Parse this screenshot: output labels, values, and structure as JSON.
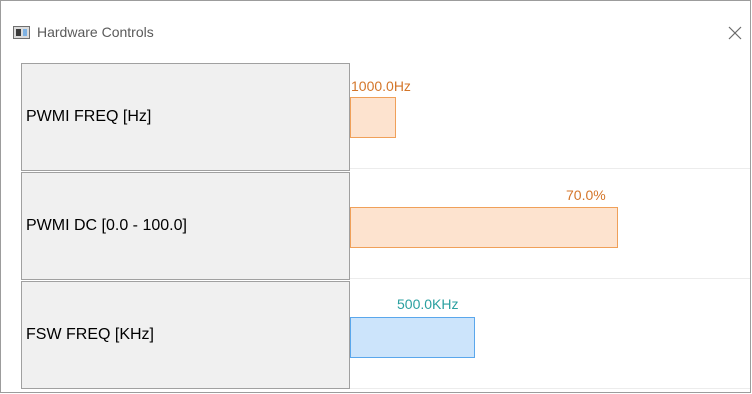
{
  "window": {
    "title": "Hardware Controls"
  },
  "rows": [
    {
      "label": "PWMI FREQ [Hz]",
      "value_text": "1000.0Hz",
      "fill_fraction": 0.17,
      "color": "#fde3cf",
      "label_color": "#d4762a"
    },
    {
      "label": "PWMI DC [0.0 - 100.0]",
      "value_text": "70.0%",
      "fill_fraction": 0.7,
      "color": "#fde3cf",
      "label_color": "#d4762a"
    },
    {
      "label": "FSW FREQ [KHz]",
      "value_text": "500.0KHz",
      "fill_fraction": 0.31,
      "color": "#cce4fb",
      "label_color": "#2aa0a0"
    }
  ]
}
